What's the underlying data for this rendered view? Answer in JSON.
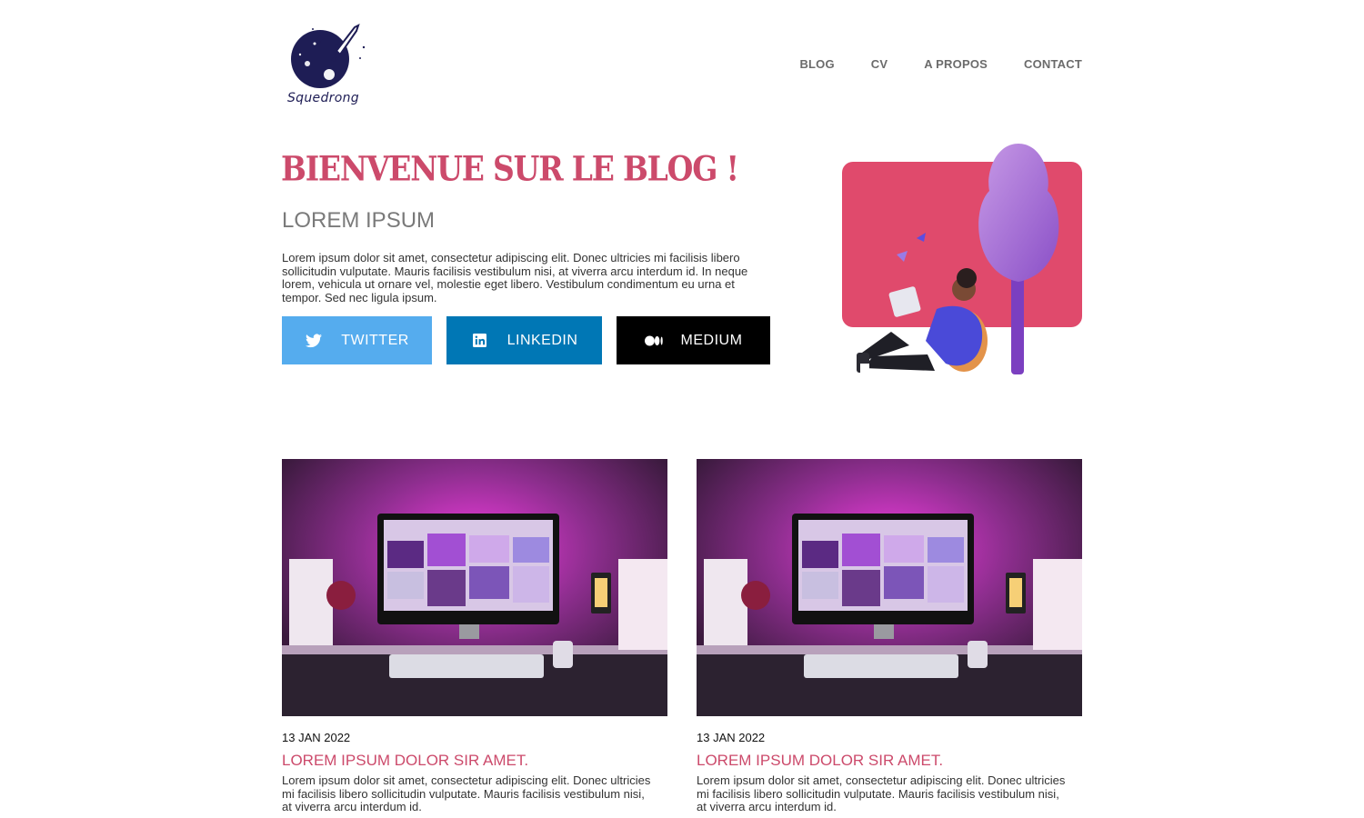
{
  "brand": {
    "name": "Squedrong",
    "primary_color": "#cc4a6b",
    "logo_color": "#1e1d55"
  },
  "nav": {
    "items": [
      {
        "label": "BLOG"
      },
      {
        "label": "CV"
      },
      {
        "label": "A PROPOS"
      },
      {
        "label": "CONTACT"
      }
    ]
  },
  "hero": {
    "title": "BIENVENUE SUR LE BLOG !",
    "subtitle": "LOREM IPSUM",
    "text": "Lorem ipsum dolor sit amet, consectetur adipiscing elit. Donec ultricies mi facilisis libero sollicitudin vulputate. Mauris facilisis vestibulum nisi, at viverra arcu interdum id. In neque lorem, vehicula ut ornare vel, molestie eget libero. Vestibulum condimentum eu urna et tempor. Sed nec ligula ipsum."
  },
  "social": {
    "twitter": {
      "label": "TWITTER",
      "icon": "twitter-icon",
      "color": "#55acee"
    },
    "linkedin": {
      "label": "LINKEDIN",
      "icon": "linkedin-icon",
      "color": "#0077b5"
    },
    "medium": {
      "label": "MEDIUM",
      "icon": "medium-icon",
      "color": "#000000"
    }
  },
  "posts": [
    {
      "date": "13 JAN 2022",
      "title": "LOREM IPSUM DOLOR SIR AMET.",
      "excerpt": "Lorem ipsum dolor sit amet, consectetur adipiscing elit. Donec ultricies mi facilisis libero sollicitudin vulputate. Mauris facilisis vestibulum nisi, at viverra arcu interdum id."
    },
    {
      "date": "13 JAN 2022",
      "title": "LOREM IPSUM DOLOR SIR AMET.",
      "excerpt": "Lorem ipsum dolor sit amet, consectetur adipiscing elit. Donec ultricies mi facilisis libero sollicitudin vulputate. Mauris facilisis vestibulum nisi, at viverra arcu interdum id."
    }
  ]
}
